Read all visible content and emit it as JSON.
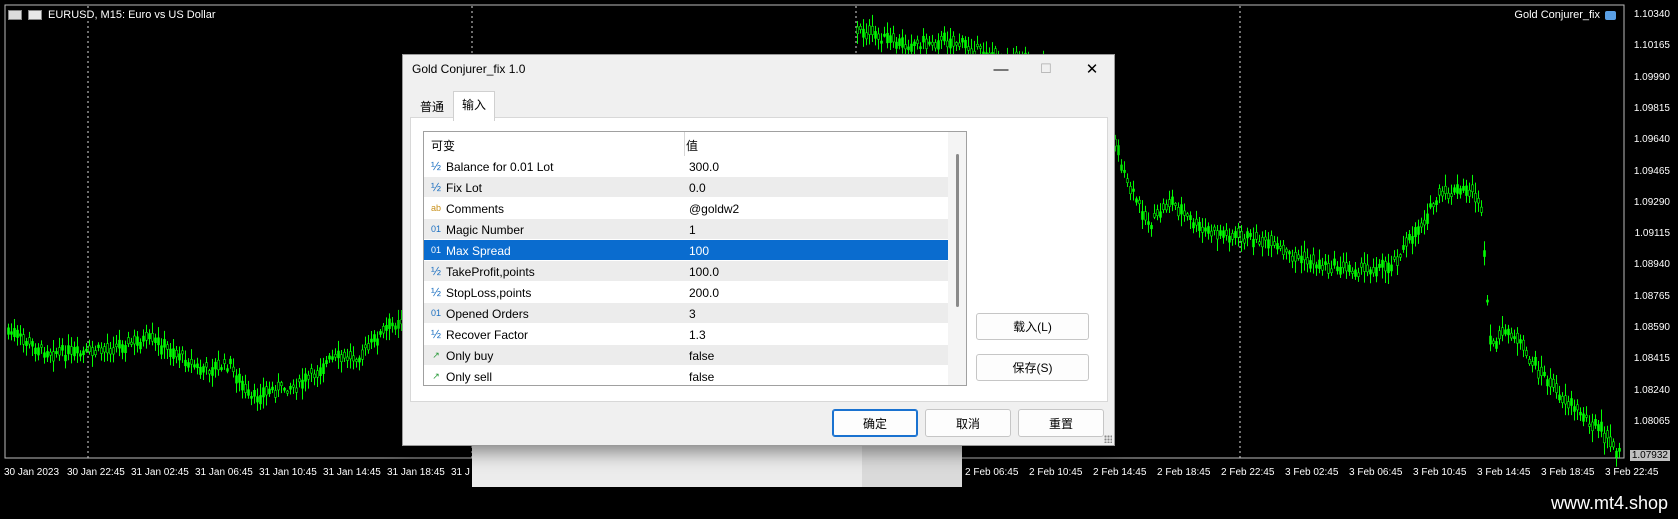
{
  "chart": {
    "symbol_title": "EURUSD, M15:  Euro vs US Dollar",
    "ea_label": "Gold Conjurer_fix",
    "price_labels": [
      "1.10340",
      "1.10165",
      "1.09990",
      "1.09815",
      "1.09640",
      "1.09465",
      "1.09290",
      "1.09115",
      "1.08940",
      "1.08765",
      "1.08590",
      "1.08415",
      "1.08240",
      "1.08065"
    ],
    "current_price": "1.07932",
    "time_labels": [
      "30 Jan 2023",
      "30 Jan 22:45",
      "31 Jan 02:45",
      "31 Jan 06:45",
      "31 Jan 10:45",
      "31 Jan 14:45",
      "31 Jan 18:45",
      "31 J",
      "2 Feb 06:45",
      "2 Feb 10:45",
      "2 Feb 14:45",
      "2 Feb 18:45",
      "2 Feb 22:45",
      "3 Feb 02:45",
      "3 Feb 06:45",
      "3 Feb 10:45",
      "3 Feb 14:45",
      "3 Feb 18:45",
      "3 Feb 22:45"
    ],
    "candle_color": "#00ff00",
    "background": "#000000"
  },
  "watermark": "www.mt4.shop",
  "dialog": {
    "title": "Gold Conjurer_fix 1.0",
    "minimize": "—",
    "maximize": "☐",
    "close": "✕",
    "tabs": [
      {
        "label": "普通",
        "active": false
      },
      {
        "label": "输入",
        "active": true
      }
    ],
    "table": {
      "col_name": "可变",
      "col_value": "值",
      "rows": [
        {
          "icon": "½",
          "icon_name": "double-type-icon",
          "name": "Balance for 0.01 Lot",
          "value": "300.0"
        },
        {
          "icon": "½",
          "icon_name": "double-type-icon",
          "name": "Fix Lot",
          "value": "0.0"
        },
        {
          "icon": "ab",
          "icon_name": "string-type-icon",
          "name": "Comments",
          "value": "@goldw2"
        },
        {
          "icon": "01",
          "icon_name": "integer-type-icon",
          "name": "Magic Number",
          "value": "1"
        },
        {
          "icon": "01",
          "icon_name": "integer-type-icon",
          "name": "Max Spread",
          "value": "100",
          "selected": true
        },
        {
          "icon": "½",
          "icon_name": "double-type-icon",
          "name": "TakeProfit,points",
          "value": "100.0"
        },
        {
          "icon": "½",
          "icon_name": "double-type-icon",
          "name": "StopLoss,points",
          "value": "200.0"
        },
        {
          "icon": "01",
          "icon_name": "integer-type-icon",
          "name": "Opened Orders",
          "value": "3"
        },
        {
          "icon": "½",
          "icon_name": "double-type-icon",
          "name": "Recover Factor",
          "value": "1.3"
        },
        {
          "icon": "↗",
          "icon_name": "bool-type-icon",
          "name": "Only buy",
          "value": "false"
        },
        {
          "icon": "↗",
          "icon_name": "bool-type-icon",
          "name": "Only sell",
          "value": "false"
        }
      ]
    },
    "load_button": "载入(L)",
    "save_button": "保存(S)",
    "ok_button": "确定",
    "cancel_button": "取消",
    "reset_button": "重置"
  }
}
